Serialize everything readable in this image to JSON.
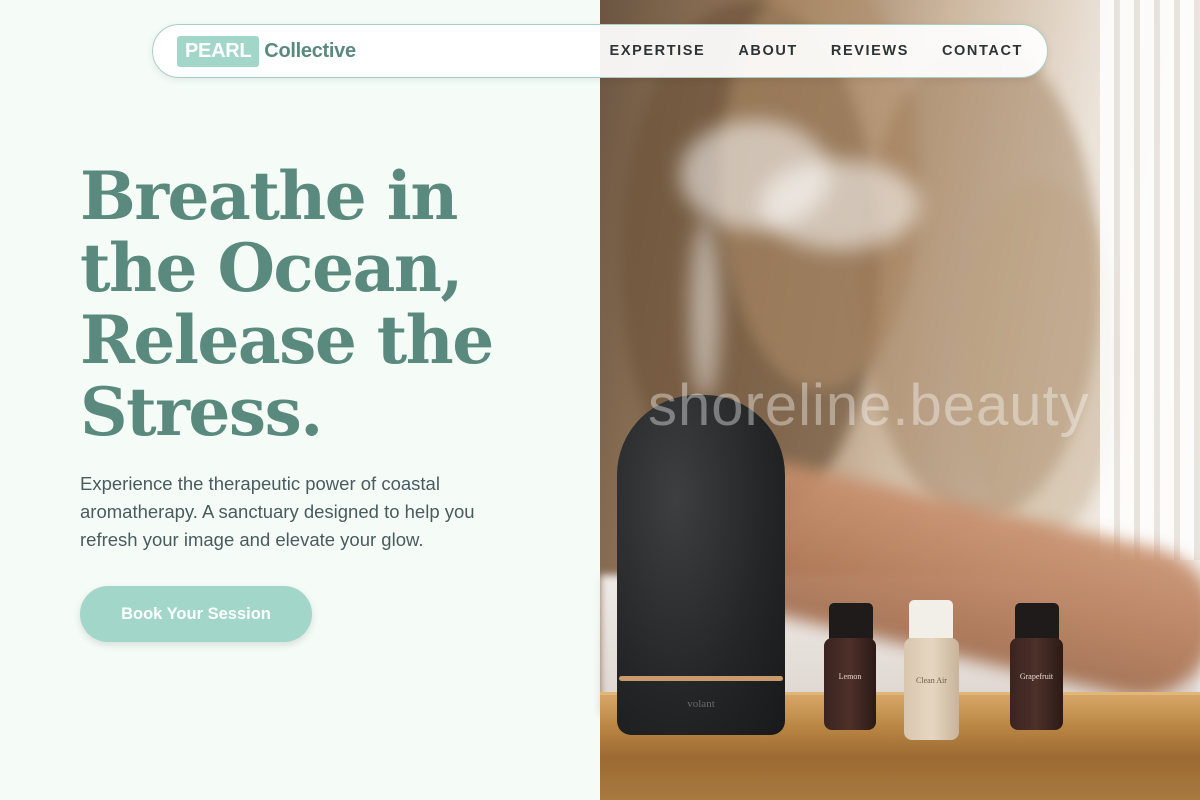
{
  "brand": {
    "badge": "PEARL",
    "name": "Collective"
  },
  "nav": {
    "items": [
      "EXPERTISE",
      "ABOUT",
      "REVIEWS",
      "CONTACT"
    ]
  },
  "hero": {
    "title": "Breathe in the Ocean, Release the Stress.",
    "text": "Experience the therapeutic power of coastal aromatherapy. A sanctuary designed to help you refresh your image and elevate your glow.",
    "cta": "Book Your Session"
  },
  "photo": {
    "watermark": "shoreline.beauty",
    "diffuser_brand": "volant",
    "bottles": [
      "Lemon",
      "Clean Air",
      "Grapefruit"
    ]
  },
  "colors": {
    "accent": "#a1d6c8",
    "heading": "#5a8a7e",
    "page_bg": "#f5fcf8"
  }
}
